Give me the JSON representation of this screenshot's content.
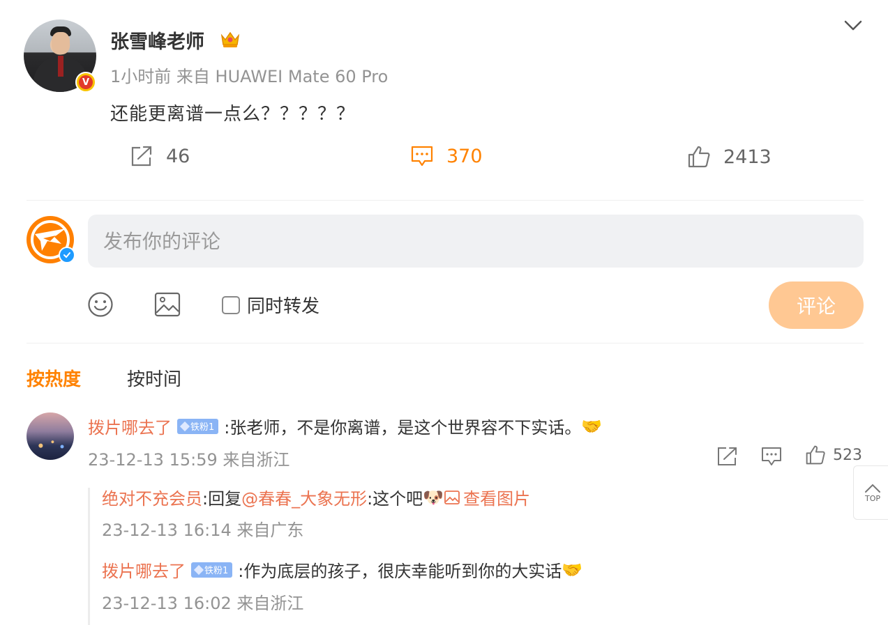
{
  "post": {
    "author": "张雪峰老师",
    "verified_badge": "V",
    "time": "1小时前",
    "source": "来自 HUAWEI Mate 60 Pro",
    "text": "还能更离谱一点么？？？？？",
    "repost_count": "46",
    "comment_count": "370",
    "like_count": "2413"
  },
  "composer": {
    "placeholder": "发布你的评论",
    "also_repost_label": "同时转发",
    "submit_label": "评论"
  },
  "sort_tabs": {
    "hot": "按热度",
    "time": "按时间"
  },
  "comments": [
    {
      "user": "拨片哪去了",
      "fan_badge": "铁粉1",
      "text": ":张老师，不是你离谱，是这个世界容不下实话。",
      "emoji": "🤝",
      "time": "23-12-13 15:59",
      "location": "来自浙江",
      "like_count": "523",
      "replies": [
        {
          "user": "绝对不充会员",
          "text_prefix": ":回复",
          "mention": "@春春_大象无形",
          "text": ":这个吧",
          "emoji": "🐶",
          "view_image": "查看图片",
          "time": "23-12-13 16:14",
          "location": "来自广东"
        },
        {
          "user": "拨片哪去了",
          "fan_badge": "铁粉1",
          "text": ":作为底层的孩子，很庆幸能听到你的大实话",
          "emoji": "🤝",
          "time": "23-12-13 16:02",
          "location": "来自浙江"
        }
      ]
    }
  ],
  "back_to_top": "TOP",
  "colors": {
    "accent": "#ff8200",
    "username": "#eb7350",
    "submit_disabled": "#ffc893",
    "meta_gray": "#939393"
  }
}
